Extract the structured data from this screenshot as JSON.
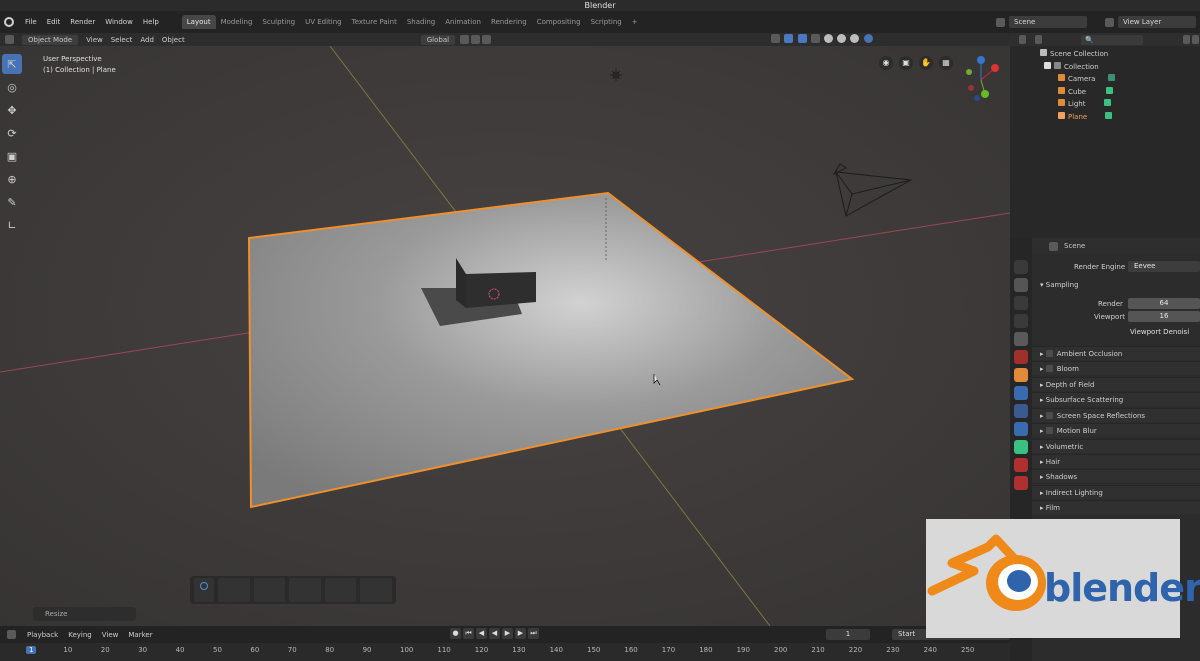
{
  "window": {
    "title": "Blender"
  },
  "menu": [
    "File",
    "Edit",
    "Render",
    "Window",
    "Help"
  ],
  "workspaces": [
    {
      "label": "Layout",
      "active": true
    },
    {
      "label": "Modeling",
      "active": false
    },
    {
      "label": "Sculpting",
      "active": false
    },
    {
      "label": "UV Editing",
      "active": false
    },
    {
      "label": "Texture Paint",
      "active": false
    },
    {
      "label": "Shading",
      "active": false
    },
    {
      "label": "Animation",
      "active": false
    },
    {
      "label": "Rendering",
      "active": false
    },
    {
      "label": "Compositing",
      "active": false
    },
    {
      "label": "Scripting",
      "active": false
    }
  ],
  "topright": {
    "scene": "Scene",
    "view_layer": "View Layer"
  },
  "viewport_header": {
    "mode": "Object Mode",
    "menus": [
      "View",
      "Select",
      "Add",
      "Object"
    ],
    "orientation": "Global"
  },
  "viewport": {
    "perspective": "User Perspective",
    "context": "(1) Collection | Plane"
  },
  "tools": [
    "select-box",
    "cursor",
    "move",
    "rotate",
    "scale",
    "transform",
    "annotate",
    "measure"
  ],
  "operator_panel": {
    "label": "Resize"
  },
  "timeline": {
    "menus": [
      "Playback",
      "Keying",
      "View",
      "Marker"
    ],
    "current_frame": "1",
    "start_label": "Start",
    "ticks": [
      "1",
      "10",
      "20",
      "30",
      "40",
      "50",
      "60",
      "70",
      "80",
      "90",
      "100",
      "110",
      "120",
      "130",
      "140",
      "150",
      "160",
      "170",
      "180",
      "190",
      "200",
      "210",
      "220",
      "230",
      "240",
      "250"
    ]
  },
  "outliner": {
    "root": "Scene Collection",
    "collection": "Collection",
    "items": [
      {
        "label": "Camera",
        "selected": false
      },
      {
        "label": "Cube",
        "selected": false
      },
      {
        "label": "Light",
        "selected": false
      },
      {
        "label": "Plane",
        "selected": true
      }
    ]
  },
  "properties": {
    "context": "Scene",
    "render_engine_label": "Render Engine",
    "render_engine": "Eevee",
    "sampling_label": "Sampling",
    "render_label": "Render",
    "render_samples": "64",
    "viewport_label": "Viewport",
    "viewport_samples": "16",
    "viewport_denoise_label": "Viewport Denoisi",
    "panels": [
      {
        "label": "Ambient Occlusion",
        "checkbox": true
      },
      {
        "label": "Bloom",
        "checkbox": true
      },
      {
        "label": "Depth of Field",
        "checkbox": false
      },
      {
        "label": "Subsurface Scattering",
        "checkbox": false
      },
      {
        "label": "Screen Space Reflections",
        "checkbox": true
      },
      {
        "label": "Motion Blur",
        "checkbox": true
      },
      {
        "label": "Volumetric",
        "checkbox": false
      },
      {
        "label": "Hair",
        "checkbox": false
      },
      {
        "label": "Shadows",
        "checkbox": false
      },
      {
        "label": "Indirect Lighting",
        "checkbox": false
      },
      {
        "label": "Film",
        "checkbox": false
      }
    ]
  },
  "brand_logo": {
    "text": "blender"
  },
  "colors": {
    "accent": "#4772b3",
    "selection_outline": "#f0902a",
    "x_axis": "#b34a5a",
    "y_axis": "#8c8c2a",
    "logo_orange": "#ef8a1a",
    "logo_blue": "#2f64ac"
  }
}
